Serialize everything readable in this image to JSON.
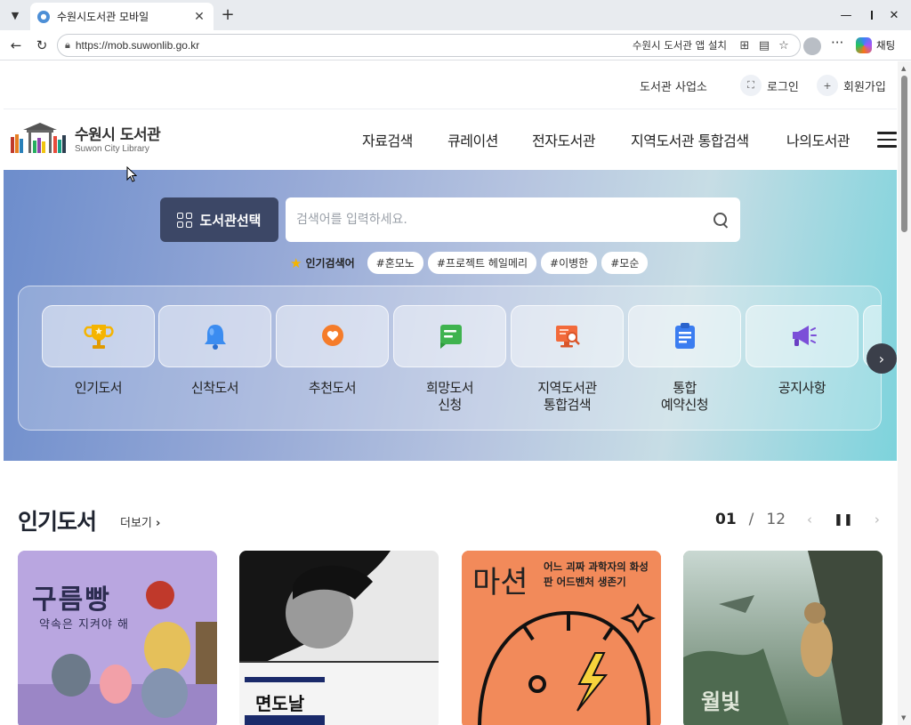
{
  "browser": {
    "tab_title": "수원시도서관 모바일",
    "url": "https://mob.suwonlib.go.kr",
    "install_label": "수원시 도서관 앱 설치",
    "copilot_label": "채팅"
  },
  "utility": {
    "business": "도서관 사업소",
    "login": "로그인",
    "signup": "회원가입"
  },
  "logo": {
    "ko": "수원시 도서관",
    "en": "Suwon City Library"
  },
  "nav": [
    "자료검색",
    "큐레이션",
    "전자도서관",
    "지역도서관 통합검색",
    "나의도서관"
  ],
  "hero": {
    "library_select": "도서관선택",
    "search_placeholder": "검색어를 입력하세요.",
    "popular_label": "인기검색어",
    "tags": [
      "#혼모노",
      "#프로젝트 헤일메리",
      "#이병한",
      "#모순"
    ],
    "quick_menu": [
      {
        "label": "인기도서",
        "icon": "trophy-icon",
        "color": "#f5b400"
      },
      {
        "label": "신착도서",
        "icon": "bell-icon",
        "color": "#3b8cf0"
      },
      {
        "label": "추천도서",
        "icon": "heart-badge-icon",
        "color": "#f57c2a"
      },
      {
        "label": "희망도서\n신청",
        "icon": "chat-book-icon",
        "color": "#3fb34f"
      },
      {
        "label": "지역도서관\n통합검색",
        "icon": "monitor-search-icon",
        "color": "#f26a3b"
      },
      {
        "label": "통합\n예약신청",
        "icon": "clipboard-icon",
        "color": "#3b7df0"
      },
      {
        "label": "공지사항",
        "icon": "megaphone-icon",
        "color": "#7b4fd8"
      }
    ]
  },
  "popular_books": {
    "title": "인기도서",
    "more": "더보기",
    "page_current": "01",
    "page_separator": "/",
    "page_total": "12",
    "books": [
      {
        "title": "구름빵",
        "subtitle": "약속은 지켜야 해",
        "bg": "#b9a6e0"
      },
      {
        "title": "면도날",
        "bg": "#f2f2f2"
      },
      {
        "title": "마션",
        "subtitle": "어느 괴짜 과학자의 화성판 어드벤처 생존기",
        "bg": "#f28a5a"
      },
      {
        "title": "월빛",
        "bg": "#7f9a86"
      }
    ]
  }
}
